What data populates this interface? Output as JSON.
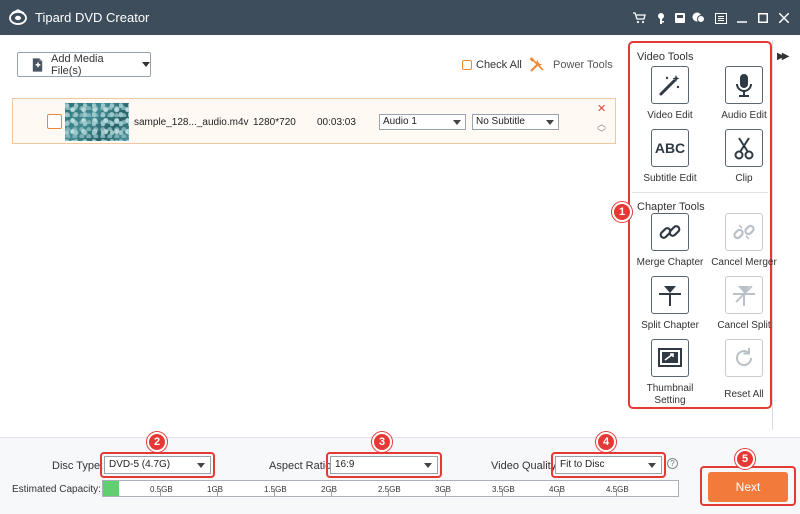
{
  "app": {
    "title": "Tipard DVD Creator"
  },
  "titlebar_icons": [
    "cart-icon",
    "key-icon",
    "register-icon",
    "chat-icon",
    "menu-icon",
    "minimize-icon",
    "maximize-icon",
    "close-icon"
  ],
  "toolbar": {
    "add_media_label": "Add Media File(s)",
    "check_all_label": "Check All",
    "power_tools_label": "Power Tools"
  },
  "media": [
    {
      "filename": "sample_128..._audio.m4v",
      "resolution": "1280*720",
      "duration": "00:03:03",
      "audio": "Audio 1",
      "subtitle": "No Subtitle"
    }
  ],
  "panel": {
    "video_tools_title": "Video Tools",
    "chapter_tools_title": "Chapter Tools",
    "video_tools": [
      {
        "label": "Video Edit",
        "icon": "magic-wand-icon"
      },
      {
        "label": "Audio Edit",
        "icon": "microphone-icon"
      },
      {
        "label": "Subtitle Edit",
        "icon": "abc-icon"
      },
      {
        "label": "Clip",
        "icon": "scissors-icon"
      }
    ],
    "chapter_tools": [
      {
        "label": "Merge Chapter",
        "icon": "link-icon"
      },
      {
        "label": "Cancel Merger",
        "icon": "broken-link-icon"
      },
      {
        "label": "Split Chapter",
        "icon": "split-icon"
      },
      {
        "label": "Cancel Split",
        "icon": "cancel-split-icon"
      },
      {
        "label": "Thumbnail Setting",
        "icon": "thumbnail-icon"
      },
      {
        "label": "Reset All",
        "icon": "reset-icon"
      }
    ],
    "abc_text": "ABC"
  },
  "bottom": {
    "disc_type_label": "Disc Type:",
    "disc_type_value": "DVD-5 (4.7G)",
    "aspect_ratio_label": "Aspect Ratio:",
    "aspect_ratio_value": "16:9",
    "video_quality_label": "Video Quality:",
    "video_quality_value": "Fit to Disc",
    "help_mark": "?",
    "capacity_label": "Estimated Capacity:",
    "capacity_ticks": [
      "0.5GB",
      "1GB",
      "1.5GB",
      "2GB",
      "2.5GB",
      "3GB",
      "3.5GB",
      "4GB",
      "4.5GB"
    ],
    "capacity_used_fraction": 0.028,
    "next_label": "Next"
  },
  "badges": [
    "1",
    "2",
    "3",
    "4",
    "5"
  ],
  "colors": {
    "titlebar": "#3d4d5c",
    "accent": "#f27a3a",
    "highlight": "#e53935",
    "capacity_fill": "#5fcf6f"
  }
}
